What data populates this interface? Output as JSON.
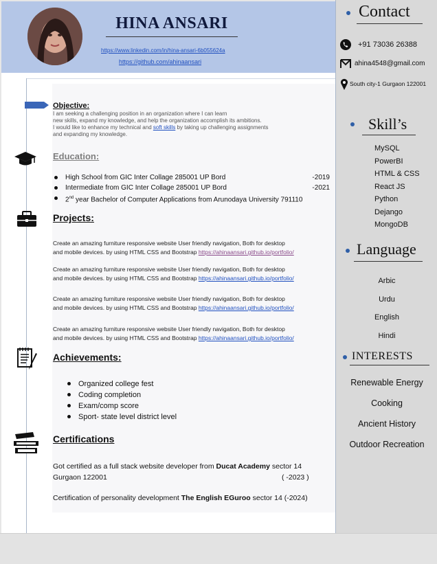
{
  "header": {
    "name": "HINA ANSARI",
    "linkedin": "https://www.linkedin.com/in/hina-ansari-6b055624a",
    "github": "https://github.com/ahinaansari"
  },
  "objective": {
    "title": "Objective:",
    "lines": [
      "I am seeking a challenging position in an organization where I can learn",
      "new skills, expand my knowledge, and help the organization accomplish its ambitions.",
      "I would like to enhance my technical and ",
      "soft skills",
      " by taking up challenging assignments",
      "and expanding my knowledge."
    ]
  },
  "education": {
    "title": "Education:",
    "items": [
      {
        "text": "High School from GIC Inter Collage 285001 UP Bord",
        "year": "-2019"
      },
      {
        "text": "Intermediate from GIC Inter Collage 285001 UP Bord",
        "year": "-2021"
      },
      {
        "pre": "2",
        "sup": "nd",
        "text": " year Bachelor of Computer Applications from Arunodaya University 791110",
        "year": ""
      }
    ]
  },
  "projects": {
    "title": "Projects:",
    "items": [
      {
        "line1": "Create an amazing furniture responsive website User friendly navigation, Both for desktop",
        "line2": "and mobile devices. by using HTML CSS and Bootstrap ",
        "link": "https://ahinaansari.github.io/portfolio/"
      },
      {
        "line1": "Create an amazing furniture responsive website User friendly navigation, Both for desktop",
        "line2": "and mobile devices. by using HTML CSS and Bootstrap ",
        "link": "https://ahinaansari.github.io/portfolio/"
      },
      {
        "line1": "Create an amazing furniture responsive website User friendly navigation, Both for desktop",
        "line2": "and mobile devices. by using HTML CSS and Bootstrap ",
        "link": "https://ahinaansari.github.io/portfolio/"
      },
      {
        "line1": "Create an amazing furniture responsive website User friendly navigation, Both for desktop",
        "line2": "and mobile devices. by using HTML CSS and Bootstrap ",
        "link": "https://ahinaansari.github.io/portfolio/"
      }
    ]
  },
  "achievements": {
    "title": "Achievements:",
    "items": [
      "Organized college fest",
      "Coding completion",
      "Exam/comp score",
      "Sport- state level district level"
    ]
  },
  "certifications": {
    "title": "Certifications",
    "c1_pre": "Got certified as a full stack website developer from ",
    "c1_bold": "Ducat Academy",
    "c1_post": " sector 14",
    "c1_line2": "Gurgaon 122001",
    "c1_year": "( -2023  )",
    "c2_pre": "Certification of personality development  ",
    "c2_bold": "The English EGuroo",
    "c2_post": " sector 14 (-2024)"
  },
  "sidebar": {
    "contact_title": "Contact",
    "phone": "+91 73036 26388",
    "email": "ahina4548@gmail.com",
    "address": "South city-1 Gurgaon 122001",
    "skills_title": "Skill’s",
    "skills": [
      "MySQL",
      "PowerBI",
      "HTML & CSS",
      "React JS",
      "Python",
      "Dejango",
      "MongoDB"
    ],
    "language_title": "Language",
    "languages": [
      "Arbic",
      "Urdu",
      "English",
      "Hindi"
    ],
    "interests_title": "INTERESTS",
    "interests": [
      "Renewable Energy",
      "Cooking",
      "Ancient History",
      "Outdoor Recreation"
    ]
  },
  "colors": {
    "header_bg": "#b4c6e7",
    "sidebar_bg": "#d9d9d9",
    "accent": "#2f5fa7",
    "link": "#1f4fbf"
  }
}
